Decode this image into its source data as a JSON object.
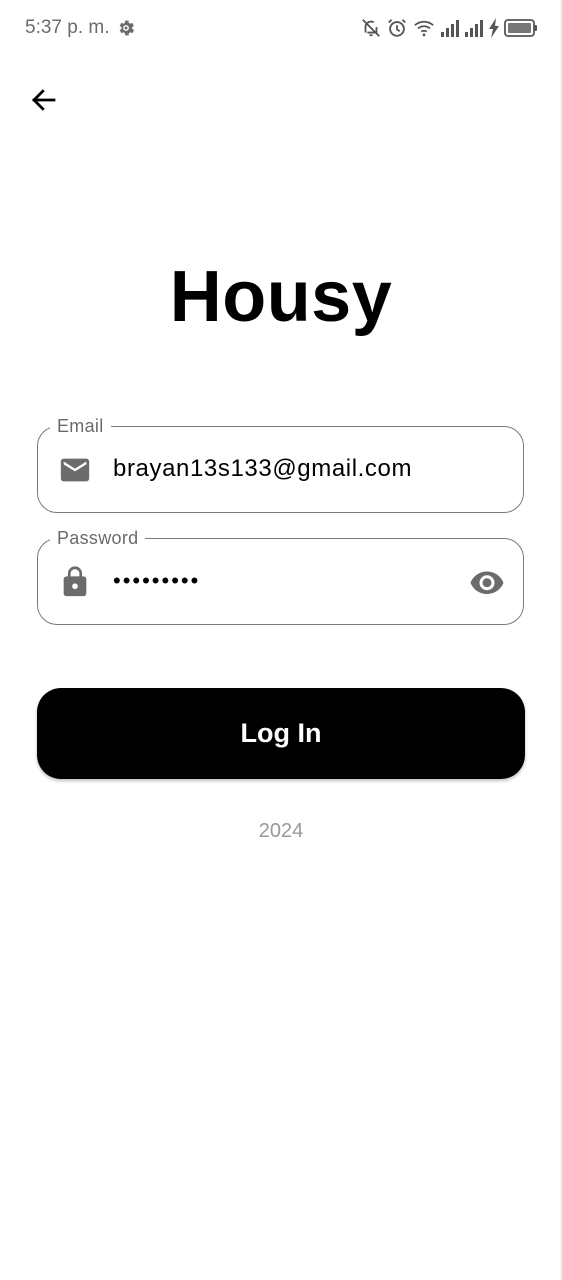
{
  "status_bar": {
    "time": "5:37 p. m.",
    "icons": [
      "gear-icon",
      "notifications-off-icon",
      "alarm-icon",
      "wifi-icon",
      "signal-icon",
      "signal-icon",
      "charging-icon",
      "battery-icon"
    ]
  },
  "navigation": {
    "back_icon": "arrow-left-icon"
  },
  "app": {
    "title": "Housy"
  },
  "form": {
    "email": {
      "label": "Email",
      "value": "brayan13s133@gmail.com",
      "icon": "mail-icon"
    },
    "password": {
      "label": "Password",
      "value": "•••••••••",
      "icon": "lock-icon",
      "toggle_icon": "eye-icon"
    },
    "submit_label": "Log In"
  },
  "footer": {
    "year": "2024"
  },
  "colors": {
    "primary": "#000000",
    "outline": "#7a7a7a",
    "label": "#6b6b6b",
    "footer_text": "#9a9a9a",
    "background": "#ffffff"
  }
}
